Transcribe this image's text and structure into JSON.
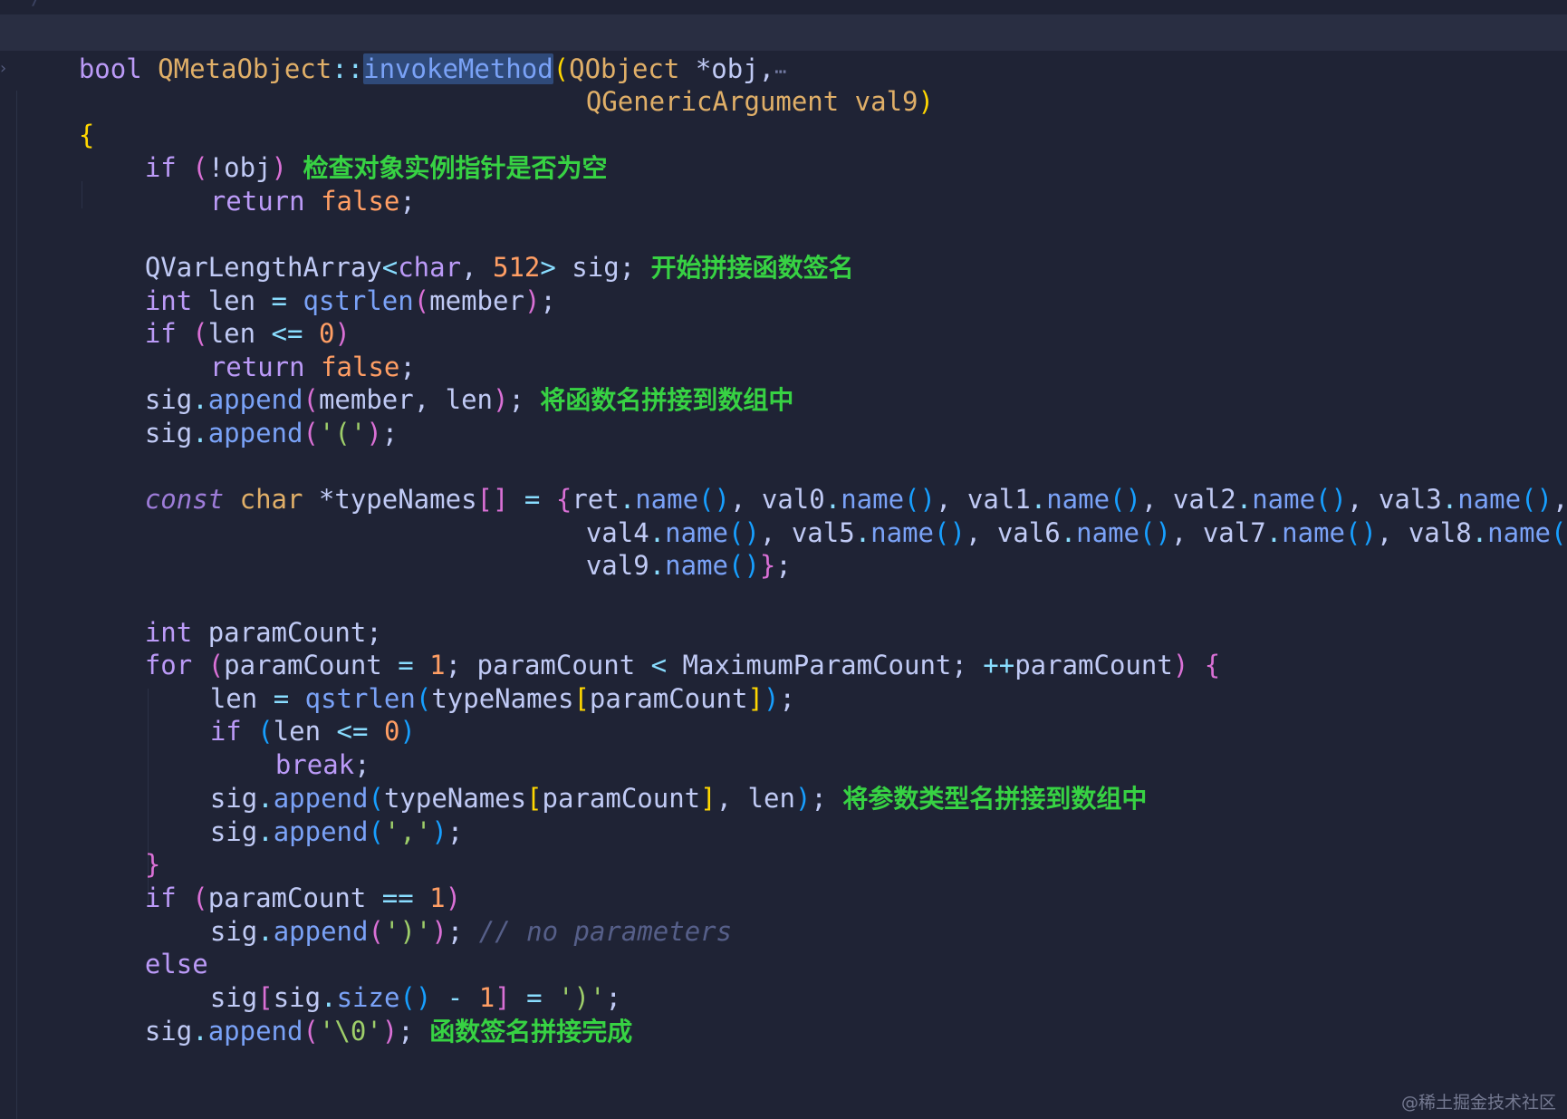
{
  "editor": {
    "l1": {
      "kw": "bool",
      "cls": "QMetaObject",
      "sep": "::",
      "method": "invokeMethod",
      "open": "(",
      "type": "QObject",
      "ptr": "*obj",
      "comma": ",",
      "fold": "⋯"
    },
    "l2": {
      "type": "QGenericArgument",
      "arg": "val9",
      "close": ")"
    },
    "l3": {
      "brace": "{"
    },
    "l4": {
      "kw": "if",
      "open": "(",
      "cond": "!obj",
      "close": ")",
      "note": "检查对象实例指针是否为空"
    },
    "l5": {
      "kw": "return",
      "val": "false",
      "semi": ";"
    },
    "l7": {
      "type": "QVarLengthArray",
      "lt": "<",
      "t2": "char",
      "comma": ", ",
      "num": "512",
      "gt": ">",
      "rest": " sig;",
      "note": "开始拼接函数签名"
    },
    "l8": {
      "kw": "int",
      "var": " len ",
      "eq": "=",
      "fn": "qstrlen",
      "open": "(",
      "arg": "member",
      "close": ")",
      "semi": ";"
    },
    "l9": {
      "kw": "if",
      "open": "(",
      "var": "len ",
      "op": "<=",
      "num": "0",
      "close": ")"
    },
    "l10": {
      "kw": "return",
      "val": "false",
      "semi": ";"
    },
    "l11": {
      "obj": "sig",
      "dot": ".",
      "fn": "append",
      "open": "(",
      "args": "member, len",
      "close": ")",
      "semi": ";",
      "note": "将函数名拼接到数组中"
    },
    "l12": {
      "obj": "sig",
      "dot": ".",
      "fn": "append",
      "open": "(",
      "str": "'('",
      "close": ")",
      "semi": ";"
    },
    "l14": {
      "kw": "const",
      "type": "char",
      "var": " *typeNames",
      "br": "[]",
      "eq": "=",
      "lb": "{",
      "items": [
        "ret",
        "val0",
        "val1",
        "val2",
        "val3"
      ],
      "call": "name",
      "paren": "()"
    },
    "l15": {
      "items": [
        "val4",
        "val5",
        "val6",
        "val7",
        "val8"
      ]
    },
    "l16": {
      "item": "val9",
      "rb": "}",
      "semi": ";"
    },
    "l18": {
      "kw": "int",
      "rest": " paramCount;"
    },
    "l19": {
      "kw": "for",
      "open": "(",
      "a": "paramCount ",
      "eq": "=",
      "num": "1",
      "b": "; paramCount ",
      "lt": "<",
      "c": " MaximumParamCount; ",
      "inc": "++",
      "d": "paramCount",
      "close": ")",
      "brace": "{"
    },
    "l20": {
      "var": "len ",
      "eq": "=",
      "fn": "qstrlen",
      "open": "(",
      "arr": "typeNames",
      "lb": "[",
      "idx": "paramCount",
      "rb": "]",
      "close": ")",
      "semi": ";"
    },
    "l21": {
      "kw": "if",
      "open": "(",
      "var": "len ",
      "op": "<=",
      "num": "0",
      "close": ")"
    },
    "l22": {
      "kw": "break",
      "semi": ";"
    },
    "l23": {
      "obj": "sig",
      "dot": ".",
      "fn": "append",
      "open": "(",
      "arr": "typeNames",
      "lb": "[",
      "idx": "paramCount",
      "rb": "]",
      "rest": ", len",
      "close": ")",
      "semi": ";",
      "note": "将参数类型名拼接到数组中"
    },
    "l24": {
      "obj": "sig",
      "dot": ".",
      "fn": "append",
      "open": "(",
      "str": "','",
      "close": ")",
      "semi": ";"
    },
    "l25": {
      "brace": "}"
    },
    "l26": {
      "kw": "if",
      "open": "(",
      "var": "paramCount ",
      "op": "==",
      "num": "1",
      "close": ")"
    },
    "l27": {
      "obj": "sig",
      "dot": ".",
      "fn": "append",
      "open": "(",
      "str": "')'",
      "close": ")",
      "semi": ";",
      "cmt": "// no parameters"
    },
    "l28": {
      "kw": "else"
    },
    "l29": {
      "obj": "sig",
      "lb": "[",
      "inner": "sig",
      "dot": ".",
      "fn": "size",
      "paren": "()",
      "minus": " - ",
      "num": "1",
      "rb": "]",
      "eq": " = ",
      "str": "')'",
      "semi": ";"
    },
    "l30": {
      "obj": "sig",
      "dot": ".",
      "fn": "append",
      "open": "(",
      "str": "'\\0'",
      "close": ")",
      "semi": ";",
      "note": "函数签名拼接完成"
    }
  },
  "watermark": "@稀土掘金技术社区"
}
